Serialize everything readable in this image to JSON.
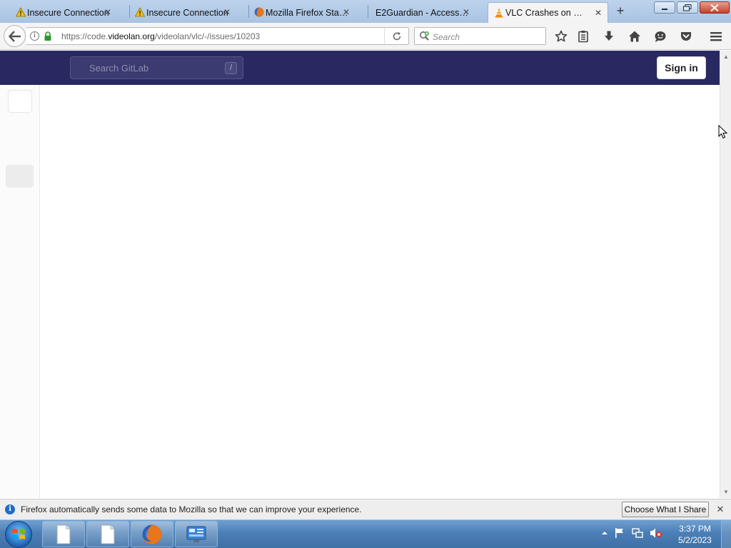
{
  "browser": {
    "tabs": [
      {
        "label": "Insecure Connection",
        "icon": "warning-icon",
        "active": false
      },
      {
        "label": "Insecure Connection",
        "icon": "warning-icon",
        "active": false
      },
      {
        "label": "Mozilla Firefox Star...",
        "icon": "firefox-icon",
        "active": false
      },
      {
        "label": "E2Guardian - Access D...",
        "icon": "none",
        "active": false
      },
      {
        "label": "VLC Crashes on no...",
        "icon": "vlc-cone-icon",
        "active": true
      }
    ],
    "new_tab": "+",
    "url": {
      "scheme_prefix": "https://code.",
      "host": "videolan.org",
      "path": "/videolan/vlc/-/issues/10203"
    },
    "search_placeholder": "Search"
  },
  "gitlab": {
    "search_placeholder": "Search GitLab",
    "search_shortcut": "/",
    "sign_in": "Sign in",
    "header_color": "#292961"
  },
  "notification": {
    "text": "Firefox automatically sends some data to Mozilla so that we can improve your experience.",
    "button": "Choose What I Share"
  },
  "taskbar": {
    "time": "3:37 PM",
    "date": "5/2/2023"
  }
}
